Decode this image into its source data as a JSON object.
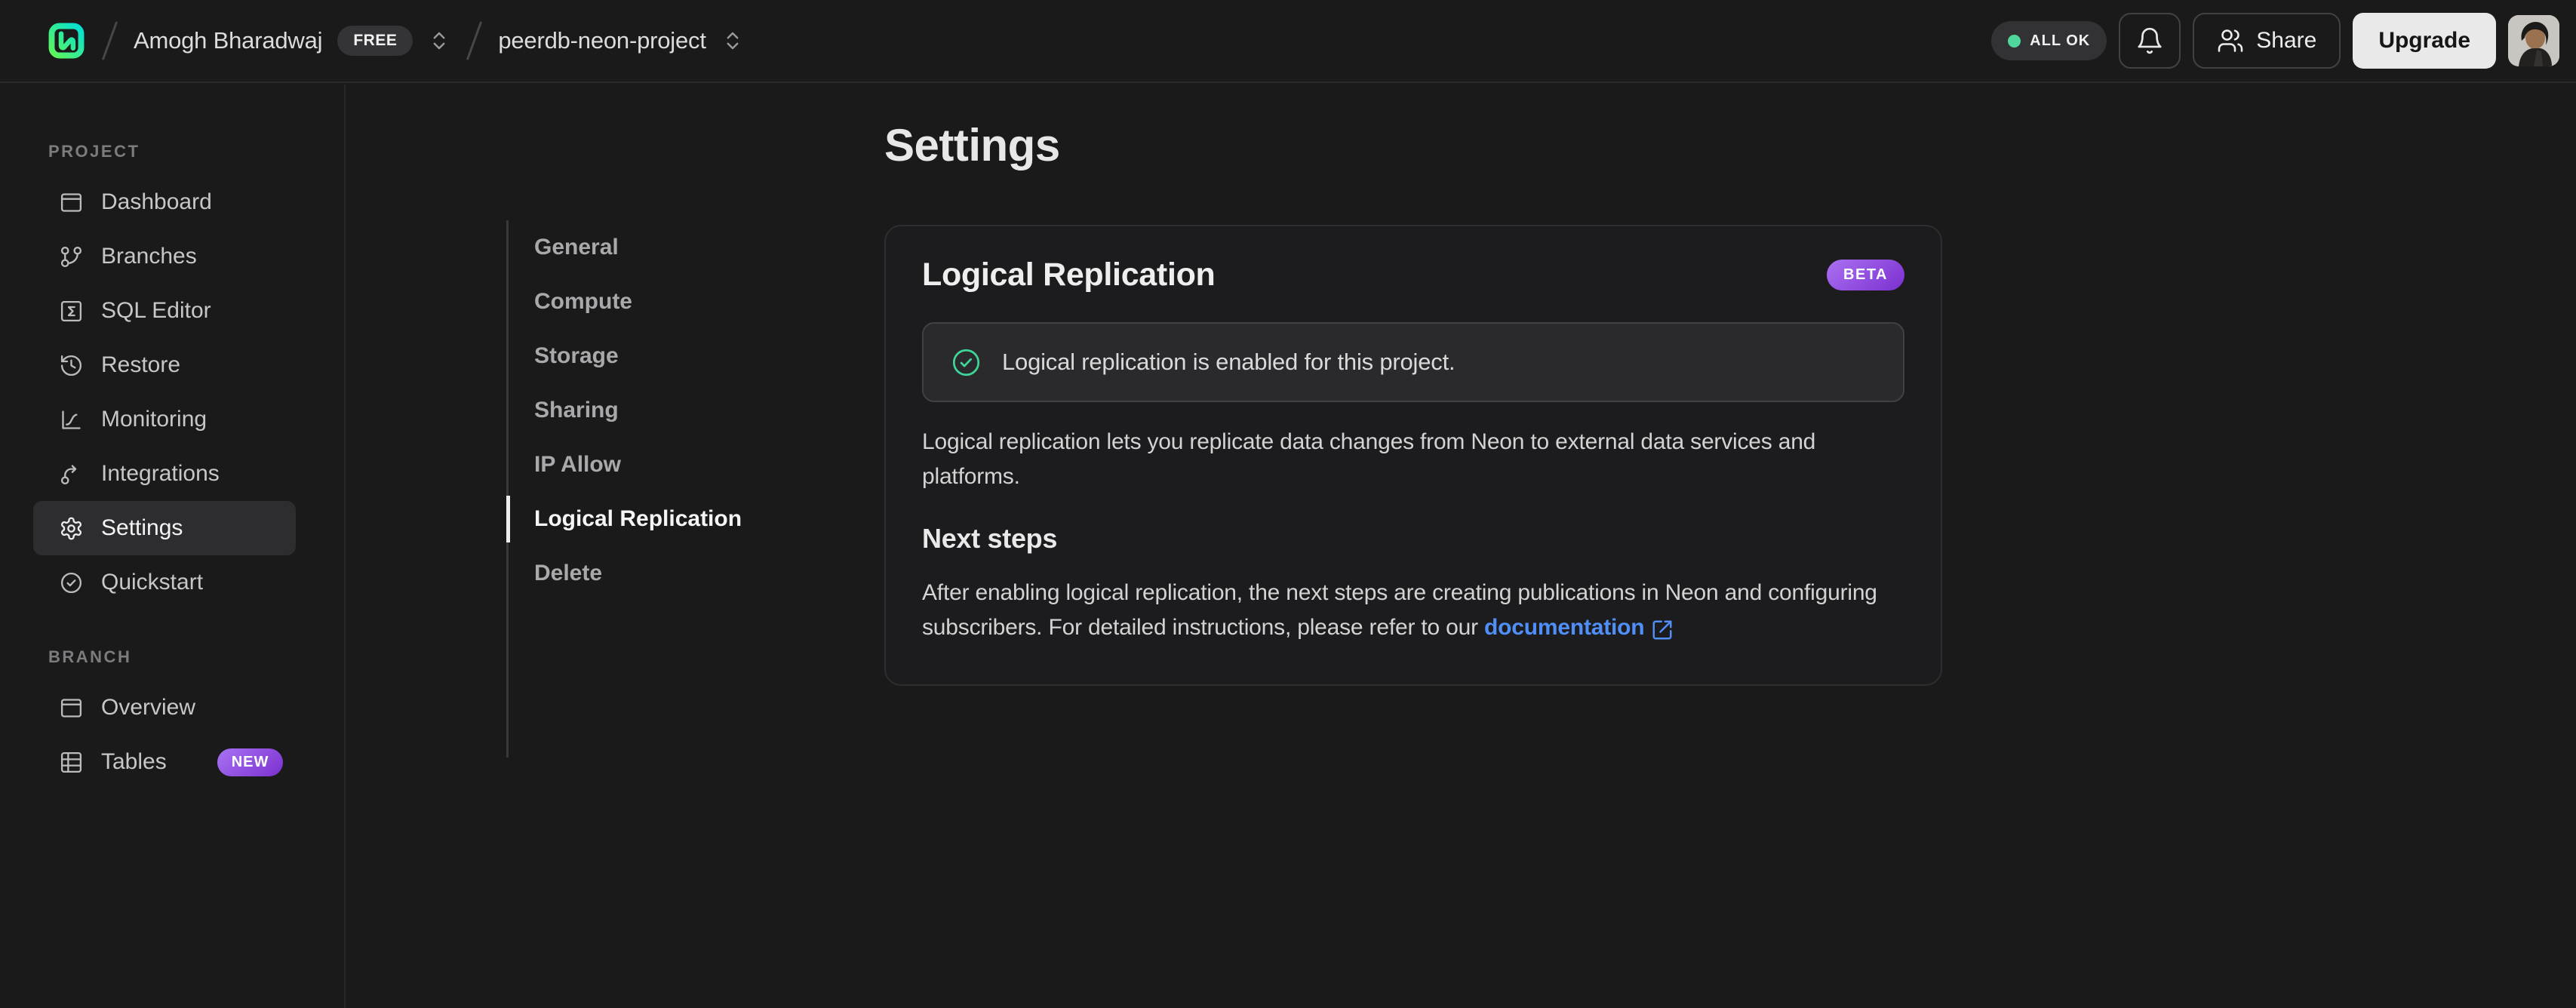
{
  "topbar": {
    "org_name": "Amogh Bharadwaj",
    "plan_badge": "FREE",
    "project_name": "peerdb-neon-project",
    "status_badge": "ALL OK",
    "share_label": "Share",
    "upgrade_label": "Upgrade"
  },
  "sidebar": {
    "sections": [
      {
        "label": "PROJECT",
        "items": [
          {
            "label": "Dashboard",
            "icon": "dashboard-icon"
          },
          {
            "label": "Branches",
            "icon": "git-branch-icon"
          },
          {
            "label": "SQL Editor",
            "icon": "sql-editor-icon"
          },
          {
            "label": "Restore",
            "icon": "restore-history-icon"
          },
          {
            "label": "Monitoring",
            "icon": "monitoring-chart-icon"
          },
          {
            "label": "Integrations",
            "icon": "integrations-icon"
          },
          {
            "label": "Settings",
            "icon": "gear-icon",
            "selected": true
          },
          {
            "label": "Quickstart",
            "icon": "check-circle-icon"
          }
        ]
      },
      {
        "label": "BRANCH",
        "items": [
          {
            "label": "Overview",
            "icon": "window-icon"
          },
          {
            "label": "Tables",
            "icon": "table-icon",
            "badge": "NEW"
          }
        ]
      }
    ]
  },
  "main": {
    "title": "Settings",
    "nav": {
      "items": [
        "General",
        "Compute",
        "Storage",
        "Sharing",
        "IP Allow",
        "Logical Replication",
        "Delete"
      ],
      "selected": "Logical Replication"
    },
    "card": {
      "title": "Logical Replication",
      "badge": "BETA",
      "alert_text": "Logical replication is enabled for this project.",
      "description": "Logical replication lets you replicate data changes from Neon to external data services and platforms.",
      "next_steps_title": "Next steps",
      "next_steps_text": "After enabling logical replication, the next steps are creating publications in Neon and configuring subscribers. For detailed instructions, please refer to our ",
      "link_label": "documentation"
    }
  },
  "colors": {
    "page_bg": "#1a1a1b",
    "card_bg": "#1c1c1e",
    "alert_bg": "#2a2a2d",
    "success_green": "#3ed598",
    "status_dot_green": "#4fd79b",
    "badge_purple_start": "#aa71f1",
    "badge_purple_end": "#7c2fd0",
    "link_blue": "#4f8ff7",
    "logo_gradient_start": "#63f655",
    "logo_gradient_end": "#00e0d9"
  }
}
